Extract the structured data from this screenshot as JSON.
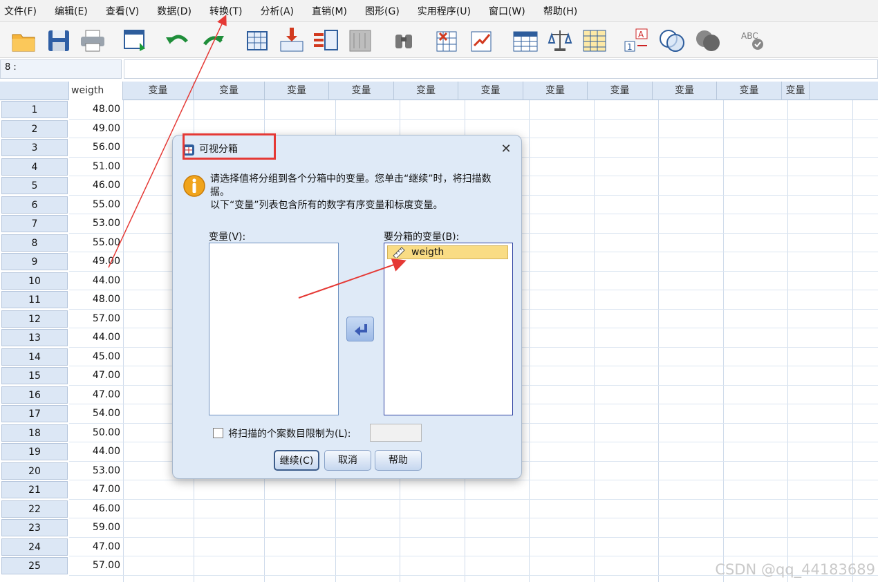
{
  "menu": [
    "文件(F)",
    "编辑(E)",
    "查看(V)",
    "数据(D)",
    "转换(T)",
    "分析(A)",
    "直销(M)",
    "图形(G)",
    "实用程序(U)",
    "窗口(W)",
    "帮助(H)"
  ],
  "toolbar_icons": [
    "open-folder-icon",
    "save-icon",
    "print-icon",
    "dialog-recall-icon",
    "undo-icon",
    "redo-icon",
    "goto-case-icon",
    "goto-variable-icon",
    "variables-icon",
    "run-descriptive-icon",
    "find-icon",
    "insert-cases-icon",
    "insert-variable-icon",
    "split-file-icon",
    "weight-cases-icon",
    "select-cases-icon",
    "value-labels-icon",
    "use-sets-icon",
    "show-all-variables-icon",
    "spell-check-icon"
  ],
  "cell_ref": "8 :",
  "cell_value": "",
  "grid": {
    "first_column_header": "weigth",
    "empty_column_header": "变量",
    "empty_columns": 11,
    "rows": [
      {
        "n": "1",
        "v": "48.00"
      },
      {
        "n": "2",
        "v": "49.00"
      },
      {
        "n": "3",
        "v": "56.00"
      },
      {
        "n": "4",
        "v": "51.00"
      },
      {
        "n": "5",
        "v": "46.00"
      },
      {
        "n": "6",
        "v": "55.00"
      },
      {
        "n": "7",
        "v": "53.00"
      },
      {
        "n": "8",
        "v": "55.00"
      },
      {
        "n": "9",
        "v": "49.00"
      },
      {
        "n": "10",
        "v": "44.00"
      },
      {
        "n": "11",
        "v": "48.00"
      },
      {
        "n": "12",
        "v": "57.00"
      },
      {
        "n": "13",
        "v": "44.00"
      },
      {
        "n": "14",
        "v": "45.00"
      },
      {
        "n": "15",
        "v": "47.00"
      },
      {
        "n": "16",
        "v": "47.00"
      },
      {
        "n": "17",
        "v": "54.00"
      },
      {
        "n": "18",
        "v": "50.00"
      },
      {
        "n": "19",
        "v": "44.00"
      },
      {
        "n": "20",
        "v": "53.00"
      },
      {
        "n": "21",
        "v": "47.00"
      },
      {
        "n": "22",
        "v": "46.00"
      },
      {
        "n": "23",
        "v": "59.00"
      },
      {
        "n": "24",
        "v": "47.00"
      },
      {
        "n": "25",
        "v": "57.00"
      }
    ]
  },
  "dialog": {
    "title": "可视分箱",
    "message_line1": "请选择值将分组到各个分箱中的变量。您单击“继续”时，将扫描数",
    "message_line2": "据。",
    "message_line3": "以下“变量”列表包含所有的数字有序变量和标度变量。",
    "variables_label": "变量(V):",
    "bin_label": "要分箱的变量(B):",
    "bin_items": [
      "weigth"
    ],
    "limit_label": "将扫描的个案数目限制为(L):",
    "limit_value": "",
    "continue_label": "继续(C)",
    "cancel_label": "取消",
    "help_label": "帮助"
  },
  "watermark": "CSDN @qq_44183689",
  "colors": {
    "annotation": "#e53935",
    "header_bg": "#dce7f5",
    "selected_item": "#f9dc84"
  }
}
